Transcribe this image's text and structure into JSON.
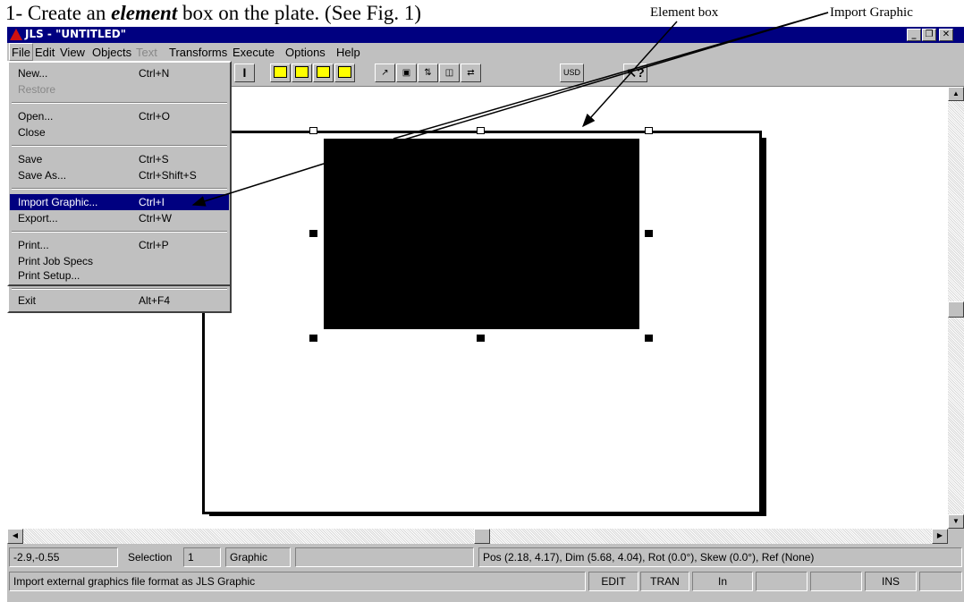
{
  "doc": {
    "step": "1-  Create an ",
    "step_emphasis": "element",
    "step_rest": " box on the plate.  (See Fig. 1)",
    "callout_element_box": "Element box",
    "callout_import_graphic": "Import Graphic"
  },
  "window": {
    "title": "JLS - \"UNTITLED\"",
    "min_glyph": "_",
    "restore_glyph": "❐",
    "close_glyph": "✕"
  },
  "menubar": {
    "file": "File",
    "edit": "Edit",
    "view": "View",
    "objects": "Objects",
    "text": "Text",
    "transforms": "Transforms",
    "execute": "Execute",
    "options": "Options",
    "help": "Help"
  },
  "toolbar": {
    "text_tool_glyph": "I",
    "usd_label": "USD",
    "help_label": "?"
  },
  "file_menu": {
    "new": "New...",
    "new_sc": "Ctrl+N",
    "restore": "Restore",
    "open": "Open...",
    "open_sc": "Ctrl+O",
    "close": "Close",
    "save": "Save",
    "save_sc": "Ctrl+S",
    "save_as": "Save As...",
    "save_as_sc": "Ctrl+Shift+S",
    "import_graphic": "Import Graphic...",
    "import_graphic_sc": "Ctrl+I",
    "export": "Export...",
    "export_sc": "Ctrl+W",
    "print": "Print...",
    "print_sc": "Ctrl+P",
    "print_job_specs": "Print Job Specs",
    "print_setup": "Print Setup...",
    "exit": "Exit",
    "exit_sc": "Alt+F4"
  },
  "status": {
    "coords": "-2.9,-0.55",
    "selection_label": "Selection",
    "selection_count": "1",
    "object_type": "Graphic",
    "empty": "",
    "geometry": "Pos (2.18, 4.17), Dim (5.68, 4.04), Rot (0.0°), Skew (0.0°), Ref (None)",
    "hint": "Import external graphics file format as JLS Graphic",
    "mode_edit": "EDIT",
    "mode_tran": "TRAN",
    "units": "In",
    "ins": "INS"
  }
}
